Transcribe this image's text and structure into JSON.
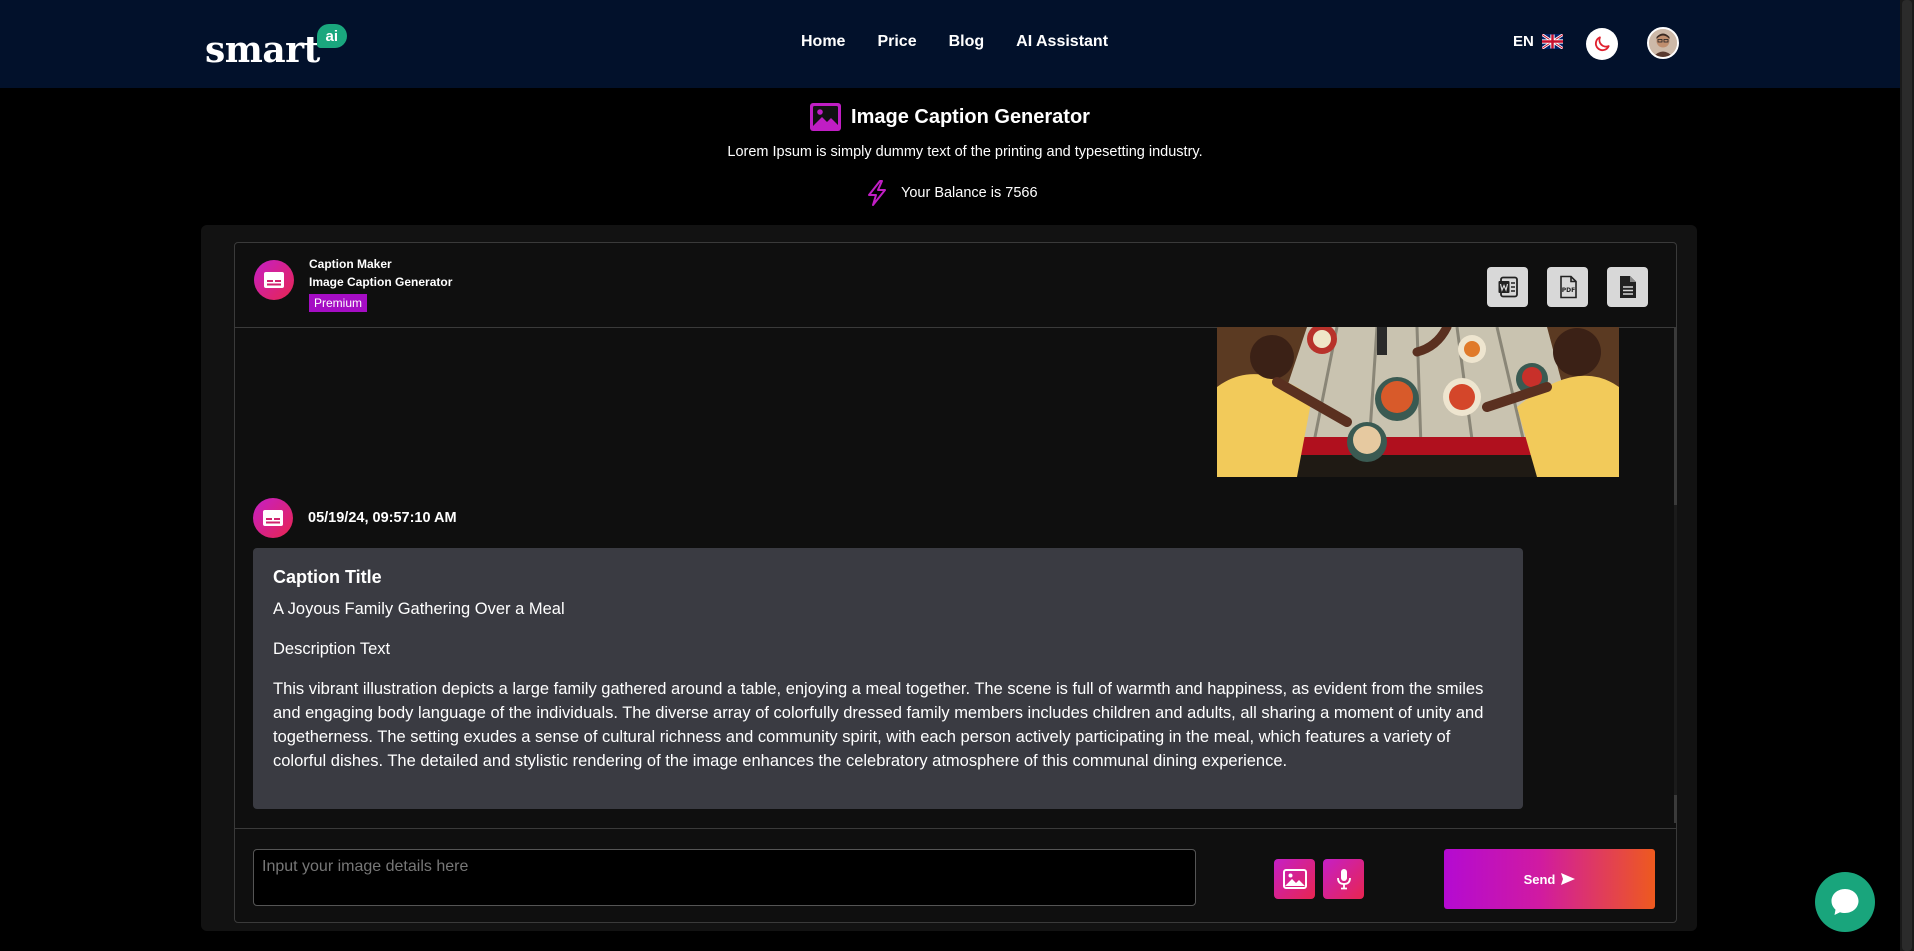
{
  "header": {
    "logo_text": "smart",
    "logo_badge": "ai",
    "nav": [
      "Home",
      "Price",
      "Blog",
      "AI Assistant"
    ],
    "language": "EN"
  },
  "page": {
    "title": "Image Caption Generator",
    "subtitle": "Lorem Ipsum is simply dummy text of the printing and typesetting industry.",
    "balance": "Your Balance is 7566"
  },
  "panel": {
    "bot_name": "Caption Maker",
    "bot_subtitle": "Image Caption Generator",
    "badge": "Premium"
  },
  "message": {
    "timestamp": "05/19/24, 09:57:10 AM",
    "caption_heading": "Caption Title",
    "caption_title": "A Joyous Family Gathering Over a Meal",
    "description_heading": "Description Text",
    "description": "This vibrant illustration depicts a large family gathered around a table, enjoying a meal together. The scene is full of warmth and happiness, as evident from the smiles and engaging body language of the individuals. The diverse array of colorfully dressed family members includes children and adults, all sharing a moment of unity and togetherness. The setting exudes a sense of cultural richness and community spirit, with each person actively participating in the meal, which features a variety of colorful dishes. The detailed and stylistic rendering of the image enhances the celebratory atmosphere of this communal dining experience."
  },
  "composer": {
    "placeholder": "Input your image details here",
    "send_label": "Send"
  },
  "colors": {
    "header_bg": "#02112b",
    "accent_gradient_start": "#c51fc7",
    "accent_gradient_end": "#ee5a1e",
    "premium": "#a50dc4",
    "chat_fab": "#19a57c"
  },
  "icons": [
    "image-icon",
    "bolt-icon",
    "caption-icon",
    "word-export-icon",
    "pdf-export-icon",
    "document-icon",
    "microphone-icon",
    "send-icon",
    "moon-icon",
    "chat-icon"
  ]
}
